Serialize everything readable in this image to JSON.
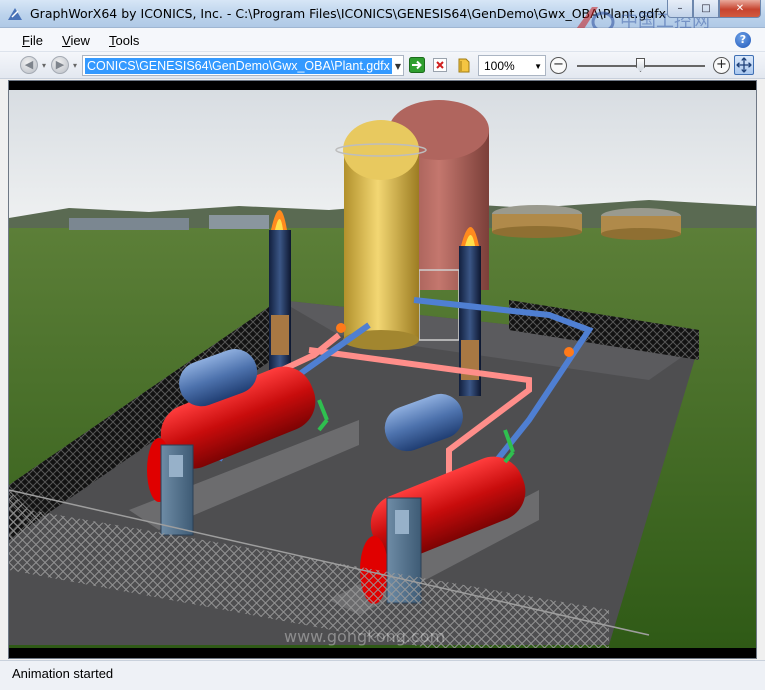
{
  "window": {
    "title": "GraphWorX64 by ICONICS, Inc. - C:\\Program Files\\ICONICS\\GENESIS64\\GenDemo\\Gwx_OBA\\Plant.gdfx",
    "minimize_glyph": "–",
    "maximize_glyph": "□",
    "close_glyph": "✕"
  },
  "watermark": {
    "logo_text": "中国工控网",
    "url_text": "www.gongkong.com"
  },
  "menu": {
    "file": "File",
    "view": "View",
    "tools": "Tools",
    "help_glyph": "?"
  },
  "toolbar": {
    "back_glyph": "◀",
    "forward_glyph": "▶",
    "address_value": "CONICS\\GENESIS64\\GenDemo\\Gwx_OBA\\Plant.gdfx",
    "zoom_value": "100%",
    "zoom_out_glyph": "−",
    "zoom_in_glyph": "+",
    "zoom_slider_level": 0.5,
    "icons": [
      "go-arrow-icon",
      "stop-icon",
      "open-folder-icon",
      "fit-to-window-icon"
    ]
  },
  "viewport": {
    "scene_watermark": "www.gongkong.com"
  },
  "status": {
    "text": "Animation started"
  },
  "colors": {
    "boiler_red": "#d10f10",
    "drum_blue": "#4f76b3",
    "tank_yellow": "#e1c353",
    "tank_red": "#b86a62",
    "stack_navy": "#1f2f57",
    "pipe_salmon": "#ff8e8a",
    "pipe_blue": "#4f7fd2",
    "fence_black": "#111111",
    "ground_green": "#3d6f22"
  }
}
